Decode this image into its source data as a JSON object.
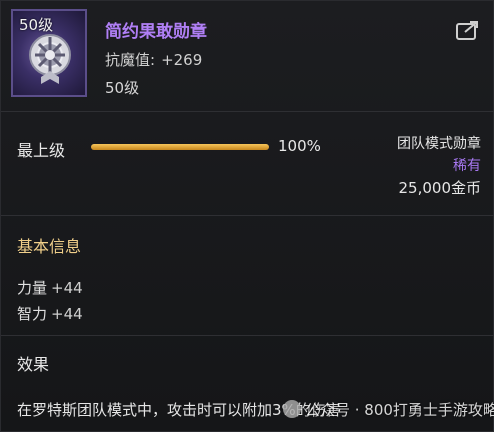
{
  "item": {
    "icon_level": "50级",
    "title": "简约果敢勋章",
    "stat_label": "抗魔值:",
    "stat_value": "+269",
    "level": "50级"
  },
  "progress": {
    "label": "最上级",
    "percent_text": "100%",
    "fraction": 1.0
  },
  "meta": {
    "type": "团队模式勋章",
    "rarity": "稀有",
    "price": "25,000金币"
  },
  "basic_info": {
    "title": "基本信息",
    "attributes": [
      {
        "name": "力量",
        "value": "+44"
      },
      {
        "name": "智力",
        "value": "+44"
      }
    ]
  },
  "effect": {
    "title": "效果",
    "text": "在罗特斯团队模式中，攻击时可以附加3%的伤害"
  },
  "watermark": {
    "text": "公众号 · 800打勇士手游攻略"
  },
  "colors": {
    "title": "#b07ff5",
    "rarity": "#a777f0",
    "section": "#f0cf8a",
    "bar": "#e0a43a"
  }
}
